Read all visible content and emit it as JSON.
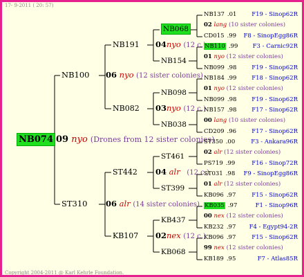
{
  "header": "17- 9-2011 ( 20: 57)",
  "footer": "Copyright 2004-2011 @ Karl Kehrle Foundation.",
  "root": {
    "id": "NB074",
    "gen": "09",
    "race": "nyo",
    "note": "(Drones from 12 sister colonies)"
  },
  "g1": [
    {
      "id": "NB100",
      "gen": "06",
      "race": "nyo",
      "note": "(12 sister colonies)"
    },
    {
      "id": "ST310",
      "gen": "06",
      "race": "alr",
      "note": "(14 sister colonies)"
    }
  ],
  "g2": [
    {
      "id": "NB191",
      "gen": "04",
      "race": "nyo",
      "note": "(12 c.)"
    },
    {
      "id": "NB082",
      "gen": "03",
      "race": "nyo",
      "note": "(12 c.)"
    },
    {
      "id": "ST442",
      "gen": "04",
      "race": "alr",
      "note": "(12 c.)"
    },
    {
      "id": "KB107",
      "gen": "02",
      "race": "nex",
      "note": "(12 c.)"
    }
  ],
  "g3": [
    "NB068",
    "NB154",
    "NB098",
    "NB038",
    "ST461",
    "ST399",
    "KB437",
    "KB068"
  ],
  "rows": [
    {
      "a": "NB137",
      "b": ".01",
      "c": "F19 - Sinop62R"
    },
    {
      "a": "02",
      "r": "lang",
      "n": "(10 sister colonies)"
    },
    {
      "a": "CD015",
      "b": ".99",
      "c": "F8 - SinopEgg86R"
    },
    {
      "a": "NB110",
      "b": ".99",
      "c": "F3 - Carnic92R"
    },
    {
      "a": "01",
      "r": "nyo",
      "n": "(12 sister colonies)"
    },
    {
      "a": "NB099",
      "b": ".98",
      "c": "F19 - Sinop62R"
    },
    {
      "a": "NB184",
      "b": ".99",
      "c": "F18 - Sinop62R"
    },
    {
      "a": "01",
      "r": "nyo",
      "n": "(12 sister colonies)"
    },
    {
      "a": "NB099",
      "b": ".98",
      "c": "F19 - Sinop62R"
    },
    {
      "a": "NB157",
      "b": ".98",
      "c": "F17 - Sinop62R"
    },
    {
      "a": "00",
      "r": "lang",
      "n": "(10 sister colonies)"
    },
    {
      "a": "CD209",
      "b": ".96",
      "c": "F17 - Sinop62R"
    },
    {
      "a": "ST350",
      "b": ".00",
      "c": "F3 - Ankara96R"
    },
    {
      "a": "02",
      "r": "alr",
      "n": "(12 sister colonies)"
    },
    {
      "a": "PS719",
      "b": ".99",
      "c": "F16 - Sinop72R"
    },
    {
      "a": "ST031",
      "b": ".98",
      "c": "F9 - SinopEgg86R"
    },
    {
      "a": "01",
      "r": "alr",
      "n": "(12 sister colonies)"
    },
    {
      "a": "KB096",
      "b": ".97",
      "c": "F15 - Sinop62R"
    },
    {
      "a": "KB035",
      "b": ".97",
      "c": "F1 - Sinop96R"
    },
    {
      "a": "00",
      "r": "nex",
      "n": "(12 sister colonies)"
    },
    {
      "a": "KB232",
      "b": ".97",
      "c": "F4 - Egypt94-2R"
    },
    {
      "a": "KB096",
      "b": ".97",
      "c": "F15 - Sinop62R"
    },
    {
      "a": "99",
      "r": "nex",
      "n": "(12 sister colonies)"
    },
    {
      "a": "KB189",
      "b": ".95",
      "c": "F7 - Atlas85R"
    }
  ],
  "colors": {
    "border": "#e6208f",
    "background": "#ffffe6",
    "highlight": "#1ee01e",
    "race": "#cc0000",
    "sister": "#7a3b9a",
    "code": "#0000cc"
  }
}
